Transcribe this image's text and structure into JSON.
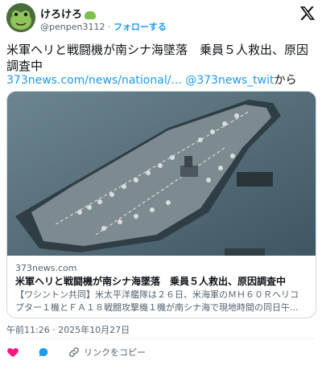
{
  "user": {
    "display_name": "けろけろ",
    "handle": "@penpen3112",
    "separator": "·",
    "follow_label": "フォローする"
  },
  "tweet": {
    "text_line1": "米軍ヘリと戦闘機が南シナ海墜落　乗員５人救出、原因",
    "text_line2": "調査中",
    "link_url": "373news.com/news/national/...",
    "link_handle": "@373news_twit",
    "link_suffix": "から"
  },
  "card": {
    "domain": "373news.com",
    "title": "米軍ヘリと戦闘機が南シナ海墜落　乗員５人救出、原因調査中",
    "desc_line1": "【ワシントン共同】米太平洋艦隊は２６日、米海軍のＭＨ６０Ｒヘリコ",
    "desc_line2": "プター１機とＦＡ１８戦闘攻撃機１機が南シナ海で現地時間の同日午..."
  },
  "meta": {
    "timestamp": "午前11:26 · 2025年10月27日"
  },
  "actions": {
    "copy_link_label": "リンクをコピー"
  },
  "icons": {
    "logo": "x-logo-icon",
    "like": "heart-icon",
    "reply": "reply-bubble-icon",
    "copy": "link-chain-icon"
  },
  "colors": {
    "accent": "#1d9bf0",
    "like": "#f91880",
    "muted": "#536471",
    "text": "#0f1419"
  }
}
